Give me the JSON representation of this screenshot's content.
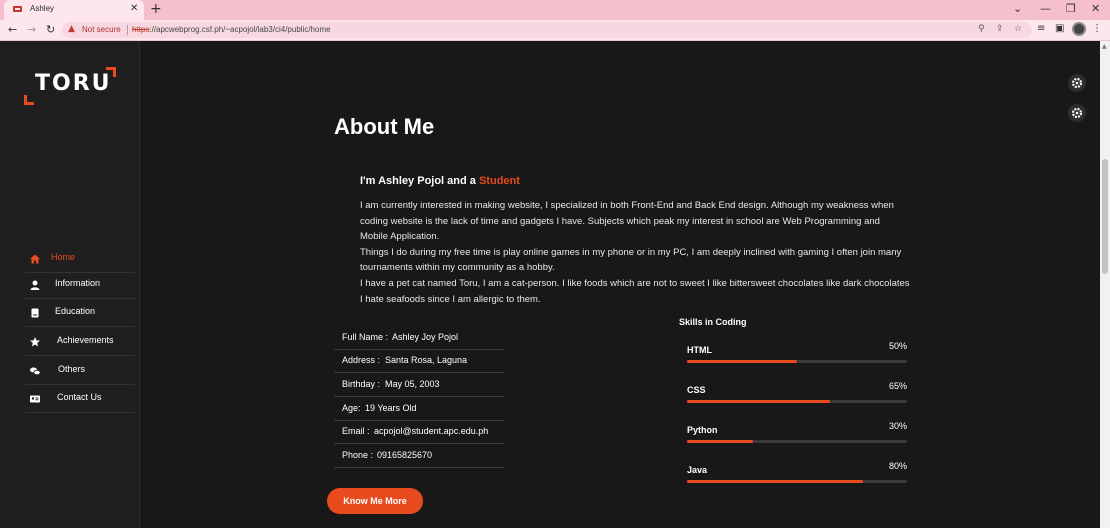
{
  "browser": {
    "tab_title": "Ashley",
    "not_secure": "Not secure",
    "url_proto": "https",
    "url_rest": "://apcwebprog.csf.ph/~acpojol/lab3/ci4/public/home"
  },
  "sidebar": {
    "logo": "TORU",
    "items": [
      {
        "label": "Home",
        "icon": "home-icon"
      },
      {
        "label": "Information",
        "icon": "user-icon"
      },
      {
        "label": "Education",
        "icon": "book-icon"
      },
      {
        "label": "Achievements",
        "icon": "star-icon"
      },
      {
        "label": "Others",
        "icon": "chat-icon"
      },
      {
        "label": "Contact Us",
        "icon": "id-card-icon"
      }
    ]
  },
  "main": {
    "title": "About Me",
    "intro_prefix": "I'm Ashley Pojol and a ",
    "intro_accent": "Student",
    "bio": [
      "I am currently interested in making website, I specialized in both Front-End and Back End design. Although my weakness when coding website is the lack of time and gadgets I have. Subjects which peak my interest in school are Web Programming and Mobile Application.",
      "Things I do during my free time is play online games in my phone or in my PC, I am deeply inclined with gaming I often join many tournaments within my community as a hobby.",
      "I have a pet cat named Toru, I am a cat-person. I like foods which are not to sweet I like bittersweet chocolates like dark chocolates I hate seafoods since I am allergic to them."
    ],
    "info": [
      {
        "key": "Full Name :",
        "value": "Ashley Joy Pojol"
      },
      {
        "key": "Address :",
        "value": "Santa Rosa, Laguna"
      },
      {
        "key": "Birthday :",
        "value": "May 05, 2003"
      },
      {
        "key": "Age:",
        "value": "19 Years Old"
      },
      {
        "key": "Email :",
        "value": "acpojol@student.apc.edu.ph"
      },
      {
        "key": "Phone :",
        "value": "09165825670"
      }
    ],
    "button": "Know Me More",
    "skills_title": "Skills in Coding",
    "skills": [
      {
        "name": "HTML",
        "percent_label": "50%",
        "level": 50
      },
      {
        "name": "CSS",
        "percent_label": "65%",
        "level": 65
      },
      {
        "name": "Python",
        "percent_label": "30%",
        "level": 30
      },
      {
        "name": "Java",
        "percent_label": "80%",
        "level": 80
      }
    ]
  },
  "colors": {
    "accent": "#e84b1e",
    "background": "#181818",
    "sidebar": "#1f1f1f"
  }
}
